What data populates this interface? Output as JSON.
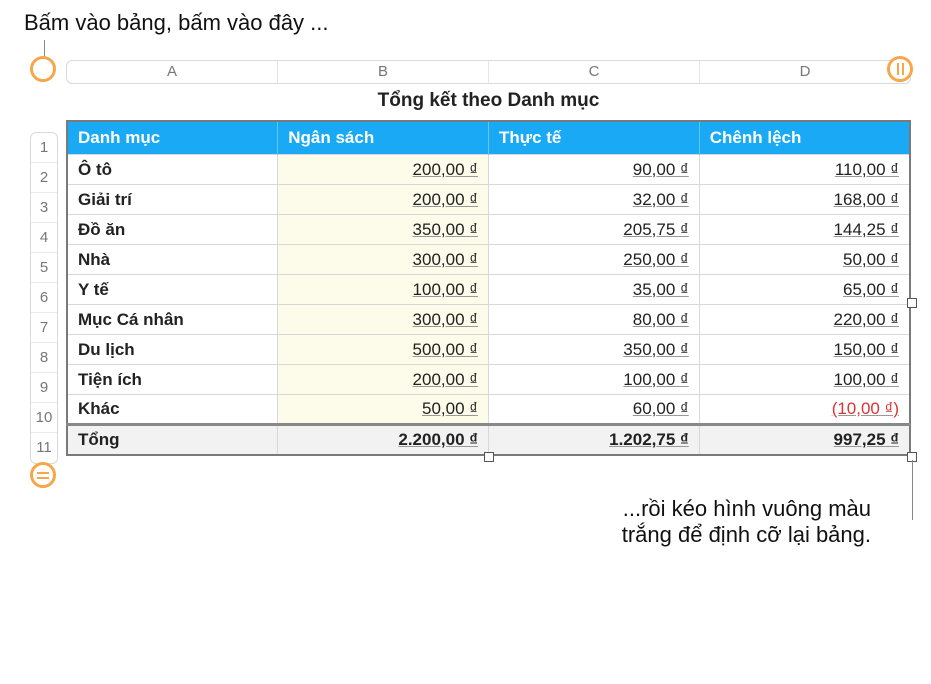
{
  "annotation_top": "Bấm vào bảng, bấm vào đây ...",
  "annotation_bottom_line1": "...rồi kéo hình vuông màu",
  "annotation_bottom_line2": "trắng để định cỡ lại bảng.",
  "columns": [
    "A",
    "B",
    "C",
    "D"
  ],
  "row_numbers": [
    "1",
    "2",
    "3",
    "4",
    "5",
    "6",
    "7",
    "8",
    "9",
    "10",
    "11"
  ],
  "table": {
    "title": "Tổng kết theo Danh mục",
    "headers": [
      "Danh mục",
      "Ngân sách",
      "Thực tế",
      "Chênh lệch"
    ],
    "rows": [
      {
        "cat": "Ô tô",
        "budget": "200,00 ₫",
        "actual": "90,00 ₫",
        "diff": "110,00 ₫"
      },
      {
        "cat": "Giải trí",
        "budget": "200,00 ₫",
        "actual": "32,00 ₫",
        "diff": "168,00 ₫"
      },
      {
        "cat": "Đồ ăn",
        "budget": "350,00 ₫",
        "actual": "205,75 ₫",
        "diff": "144,25 ₫"
      },
      {
        "cat": "Nhà",
        "budget": "300,00 ₫",
        "actual": "250,00 ₫",
        "diff": "50,00 ₫"
      },
      {
        "cat": "Y tế",
        "budget": "100,00 ₫",
        "actual": "35,00 ₫",
        "diff": "65,00 ₫"
      },
      {
        "cat": "Mục Cá nhân",
        "budget": "300,00 ₫",
        "actual": "80,00 ₫",
        "diff": "220,00 ₫"
      },
      {
        "cat": "Du lịch",
        "budget": "500,00 ₫",
        "actual": "350,00 ₫",
        "diff": "150,00 ₫"
      },
      {
        "cat": "Tiện ích",
        "budget": "200,00 ₫",
        "actual": "100,00 ₫",
        "diff": "100,00 ₫"
      },
      {
        "cat": "Khác",
        "budget": "50,00 ₫",
        "actual": "60,00 ₫",
        "diff": "(10,00 ₫)",
        "neg": true
      }
    ],
    "footer": {
      "cat": "Tổng",
      "budget": "2.200,00 ₫",
      "actual": "1.202,75 ₫",
      "diff": "997,25 ₫"
    }
  }
}
